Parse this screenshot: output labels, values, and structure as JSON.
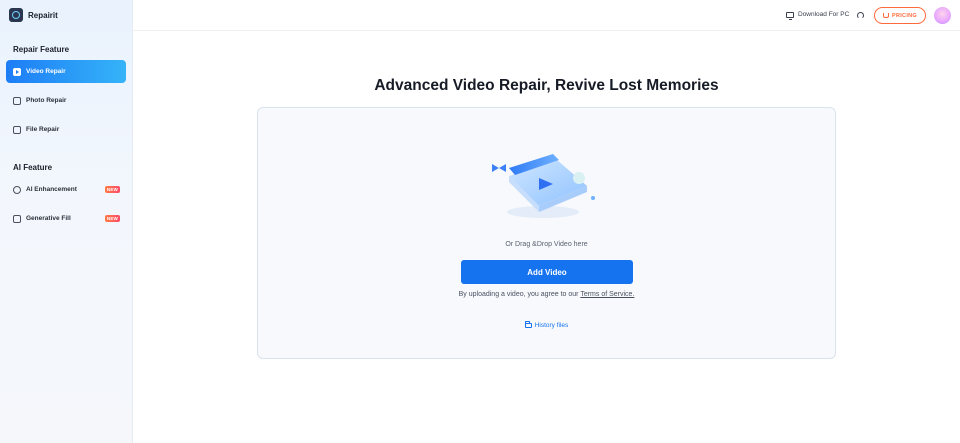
{
  "app": {
    "name": "Repairit"
  },
  "sidebar": {
    "repair_section_title": "Repair Feature",
    "repair_items": [
      {
        "label": "Video Repair",
        "icon": "video-play-icon",
        "active": true
      },
      {
        "label": "Photo Repair",
        "icon": "photo-icon",
        "active": false
      },
      {
        "label": "File Repair",
        "icon": "file-icon",
        "active": false
      }
    ],
    "ai_section_title": "AI Feature",
    "ai_items": [
      {
        "label": "AI Enhancement",
        "icon": "ai-enhancement-icon",
        "badge": "NEW"
      },
      {
        "label": "Generative Fill",
        "icon": "generative-fill-icon",
        "badge": "NEW"
      }
    ]
  },
  "topbar": {
    "download_label": "Download For PC",
    "pricing_label": "PRICING"
  },
  "main": {
    "headline": "Advanced Video Repair, Revive Lost Memories",
    "drag_text": "Or Drag &Drop Video here",
    "add_button": "Add Video",
    "terms_prefix": "By uploading a video, you agree to our",
    "terms_link": "Terms of Service.",
    "history_label": "History files"
  },
  "colors": {
    "accent": "#1673f0",
    "pricing": "#ff6a3d",
    "badge": "#ff5a5a"
  }
}
